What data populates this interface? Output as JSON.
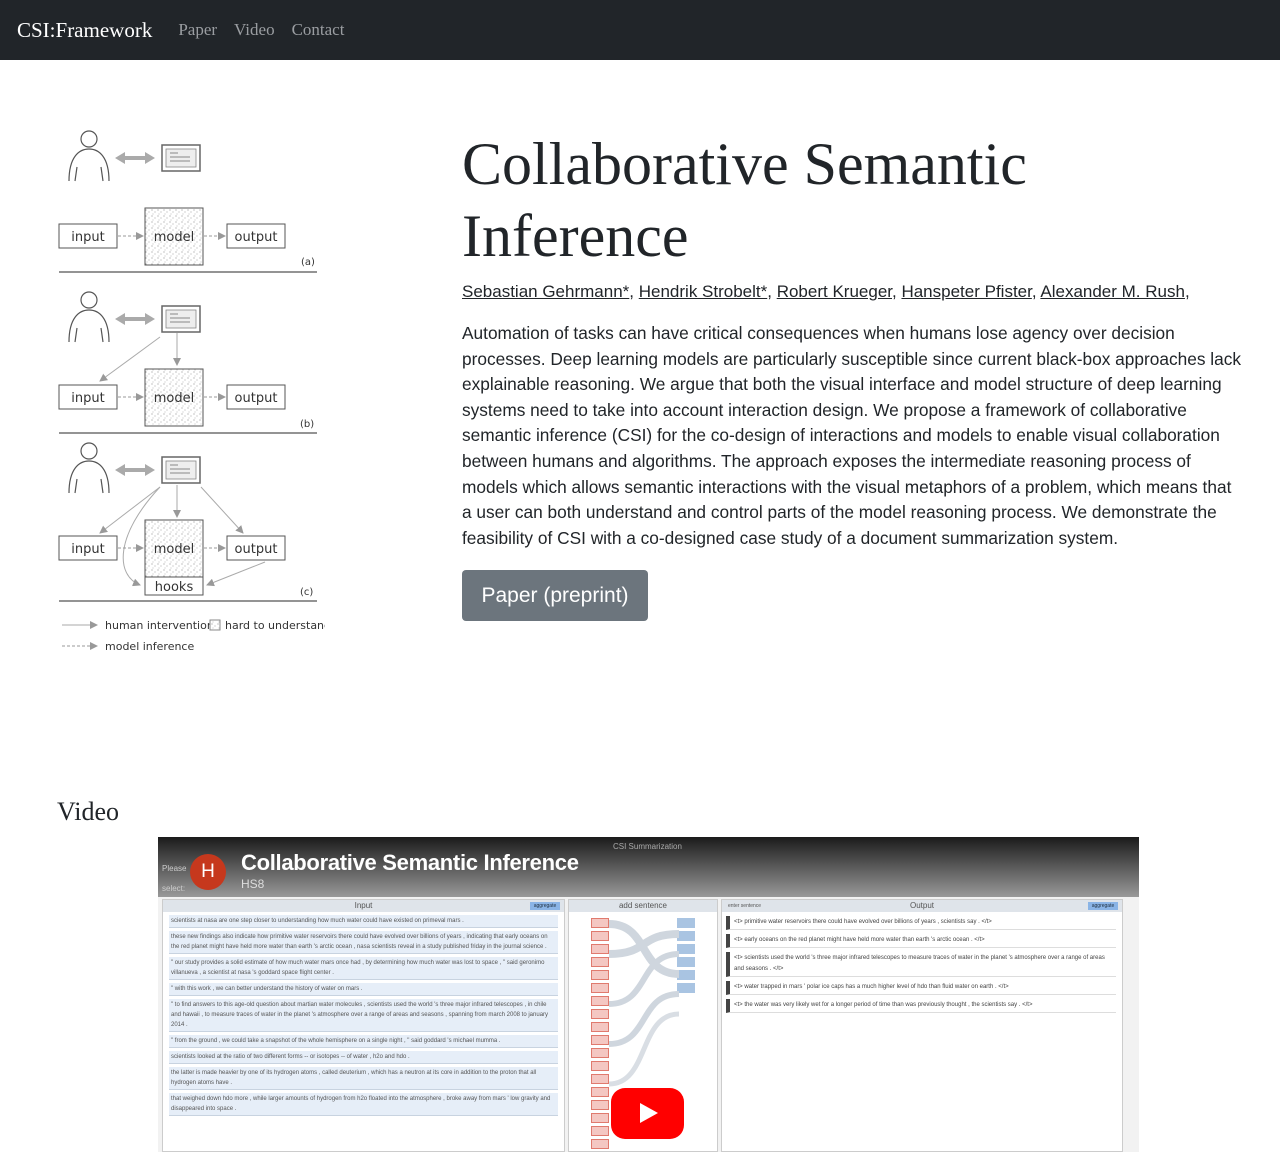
{
  "nav": {
    "brand": "CSI:Framework",
    "links": [
      "Paper",
      "Video",
      "Contact"
    ]
  },
  "figure": {
    "labels": {
      "input": "input",
      "model": "model",
      "output": "output",
      "hooks": "hooks",
      "panel_a": "(a)",
      "panel_b": "(b)",
      "panel_c": "(c)"
    },
    "legend": {
      "human": "human intervention",
      "hard": "hard to understand",
      "model": "model inference"
    }
  },
  "hero": {
    "title": "Collaborative Semantic Inference",
    "authors": [
      "Sebastian Gehrmann*",
      "Hendrik Strobelt*",
      "Robert Krueger",
      "Hanspeter Pfister",
      "Alexander M. Rush"
    ],
    "abstract": "Automation of tasks can have critical consequences when humans lose agency over decision processes. Deep learning models are particularly susceptible since current black-box approaches lack explainable reasoning. We argue that both the visual interface and model structure of deep learning systems need to take into account interaction design. We propose a framework of collaborative semantic inference (CSI) for the co-design of interactions and models to enable visual collaboration between humans and algorithms. The approach exposes the intermediate reasoning process of models which allows semantic interactions with the visual metaphors of a problem, which means that a user can both understand and control parts of the model reasoning process. We demonstrate the feasibility of CSI with a co-designed case study of a document summarization system.",
    "button": "Paper (preprint)"
  },
  "video": {
    "heading": "Video",
    "title": "Collaborative Semantic Inference",
    "channel": "HS8",
    "avatar_letter": "H",
    "app_title": "CSI Summarization",
    "please": "Please",
    "select": "select:",
    "input_header": "Input",
    "output_header": "Output",
    "aggregate": "aggregate",
    "add_sentence": "add sentence",
    "enter_sentence": "enter sentence",
    "input_rows": [
      "scientists at nasa are one step closer to understanding how much water could have existed on primeval mars .",
      "these new findings also indicate how primitive water reservoirs there could have evolved over billions of years , indicating that early oceans on the red planet might have held more water than earth 's arctic ocean , nasa scientists reveal in a study published friday in the journal science .",
      "\" our study provides a solid estimate of how much water mars once had , by determining how much water was lost to space , \" said geronimo villanueva , a scientist at nasa 's goddard space flight center .",
      "\" with this work , we can better understand the history of water on mars .",
      "\" to find answers to this age-old question about martian water molecules , scientists used the world 's three major infrared telescopes , in chile and hawaii , to measure traces of water in the planet 's atmosphere over a range of areas and seasons , spanning from march 2008 to january 2014 .",
      "\" from the ground , we could take a snapshot of the whole hemisphere on a single night , \" said goddard 's michael mumma .",
      "scientists looked at the ratio of two different forms -- or isotopes -- of water , h2o and hdo .",
      "the latter is made heavier by one of its hydrogen atoms , called deuterium , which has a neutron at its core in addition to the proton that all hydrogen atoms have .",
      "that weighed down hdo more , while larger amounts of hydrogen from h2o floated into the atmosphere , broke away from mars ' low gravity and disappeared into space ."
    ],
    "output_rows": [
      "<t> primitive water reservoirs there could have evolved over billions of years , scientists say . </t>",
      "<t> early oceans on the red planet might have held more water than earth 's arctic ocean . </t>",
      "<t> scientists used the world 's three major infrared telescopes to measure traces of water in the planet 's atmosphere over a range of areas and seasons . </t>",
      "<t> water trapped in mars ' polar ice caps has a much higher level of hdo than fluid water on earth . </t>",
      "<t> the water was very likely wet for a longer period of time than was previously thought , the scientists say . </t>"
    ]
  },
  "colors": {
    "navbar": "#212529",
    "button": "#6c757d",
    "play": "#ff0000",
    "avatar": "#c6381d"
  }
}
